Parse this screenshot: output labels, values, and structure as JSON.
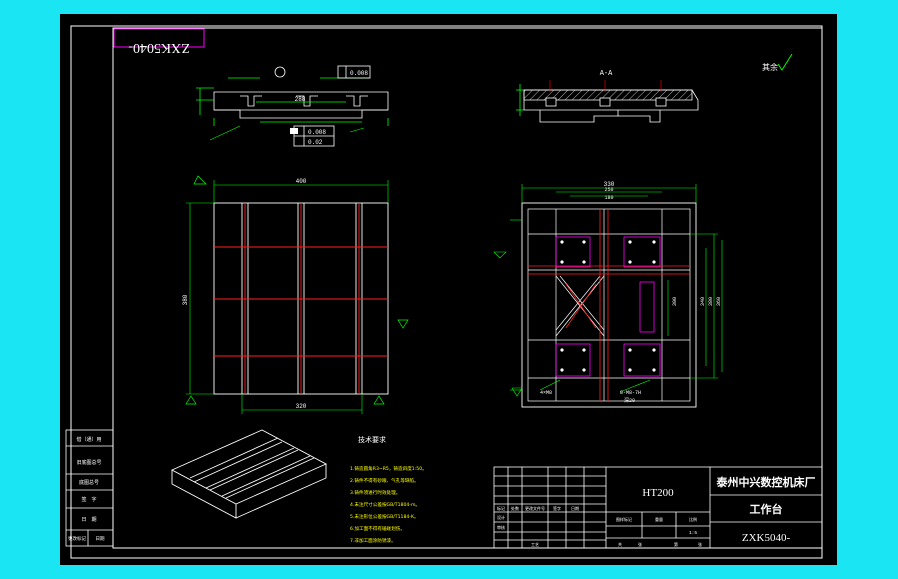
{
  "drawing": {
    "corner_code": "ZXK5040-",
    "roughness_note": "其余",
    "section_label": "A-A",
    "tech_requirements_title": "技术要求",
    "tech_requirements": [
      "1.铸造圆角R3~R5，铸造斜度1:50。",
      "2.铸件不得有砂眼、气孔等缺陷。",
      "3.铸件须进行时效处理。",
      "4.未注尺寸公差按GB/T1804-m。",
      "5.未注形位公差按GB/T1184-K。",
      "6.加工面不得有磕碰划伤。",
      "7.非加工面涂防锈漆。"
    ],
    "left_panel_rows": [
      "借（通）用",
      "旧底图总号",
      "底图总号",
      "签　字",
      "日　期"
    ],
    "left_panel_bottom": [
      "更改标记",
      "日期"
    ],
    "dimensions": {
      "front_top": "400",
      "front_bottom": "320",
      "front_left": "380",
      "side_mid": "288",
      "plan_top": "330",
      "plan_second": "250",
      "plan_third": "180",
      "plan_right_a": "380",
      "plan_right_b": "360",
      "plan_right_c": "340",
      "plan_right_d": "300",
      "note_holes": "4×M8",
      "note_slot": "8-M8-7H",
      "note_depth": "深20"
    },
    "gdt": {
      "flatness": "0.008",
      "perp": "0.008",
      "parallel": "0.02"
    }
  },
  "title_block": {
    "material": "HT200",
    "company": "泰州中兴数控机床厂",
    "part_name": "工作台",
    "drawing_no": "ZXK5040-",
    "small_labels": [
      "标记",
      "处数",
      "更改文件号",
      "签字",
      "日期"
    ],
    "row_labels": [
      "设计",
      "审核",
      "工艺",
      "标准化",
      "批准"
    ],
    "header_labels": [
      "图样标记",
      "重量",
      "比例"
    ],
    "scale": "1:5",
    "sheet_labels": [
      "共",
      "张",
      "第",
      "张"
    ]
  }
}
